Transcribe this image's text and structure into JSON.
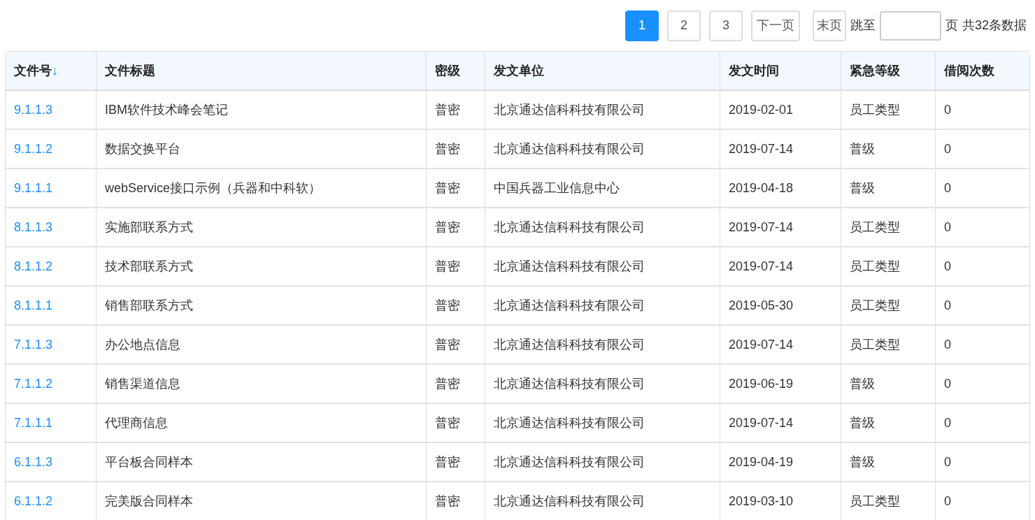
{
  "pagination": {
    "pages": [
      {
        "label": "1",
        "selected": true
      },
      {
        "label": "2",
        "selected": false
      },
      {
        "label": "3",
        "selected": false
      }
    ],
    "next": "下一页",
    "last": "末页",
    "jump_label": "跳至",
    "page_unit": "页",
    "total": "共32条数据"
  },
  "table": {
    "columns": [
      {
        "label": "文件号",
        "sort_indicator": "↓"
      },
      {
        "label": "文件标题"
      },
      {
        "label": "密级"
      },
      {
        "label": "发文单位"
      },
      {
        "label": "发文时间"
      },
      {
        "label": "紧急等级"
      },
      {
        "label": "借阅次数"
      }
    ],
    "rows": [
      [
        "9.1.1.3",
        "IBM软件技术峰会笔记",
        "普密",
        "北京通达信科科技有限公司",
        "2019-02-01",
        "员工类型",
        "0"
      ],
      [
        "9.1.1.2",
        "数据交换平台",
        "普密",
        "北京通达信科科技有限公司",
        "2019-07-14",
        "普级",
        "0"
      ],
      [
        "9.1.1.1",
        "webService接口示例（兵器和中科软）",
        "普密",
        "中国兵器工业信息中心",
        "2019-04-18",
        "普级",
        "0"
      ],
      [
        "8.1.1.3",
        "实施部联系方式",
        "普密",
        "北京通达信科科技有限公司",
        "2019-07-14",
        "员工类型",
        "0"
      ],
      [
        "8.1.1.2",
        "技术部联系方式",
        "普密",
        "北京通达信科科技有限公司",
        "2019-07-14",
        "员工类型",
        "0"
      ],
      [
        "8.1.1.1",
        "销售部联系方式",
        "普密",
        "北京通达信科科技有限公司",
        "2019-05-30",
        "员工类型",
        "0"
      ],
      [
        "7.1.1.3",
        "办公地点信息",
        "普密",
        "北京通达信科科技有限公司",
        "2019-07-14",
        "员工类型",
        "0"
      ],
      [
        "7.1.1.2",
        "销售渠道信息",
        "普密",
        "北京通达信科科技有限公司",
        "2019-06-19",
        "普级",
        "0"
      ],
      [
        "7.1.1.1",
        "代理商信息",
        "普密",
        "北京通达信科科技有限公司",
        "2019-07-14",
        "普级",
        "0"
      ],
      [
        "6.1.1.3",
        "平台板合同样本",
        "普密",
        "北京通达信科科技有限公司",
        "2019-04-19",
        "普级",
        "0"
      ],
      [
        "6.1.1.2",
        "完美版合同样本",
        "普密",
        "北京通达信科科技有限公司",
        "2019-03-10",
        "员工类型",
        "0"
      ]
    ]
  }
}
